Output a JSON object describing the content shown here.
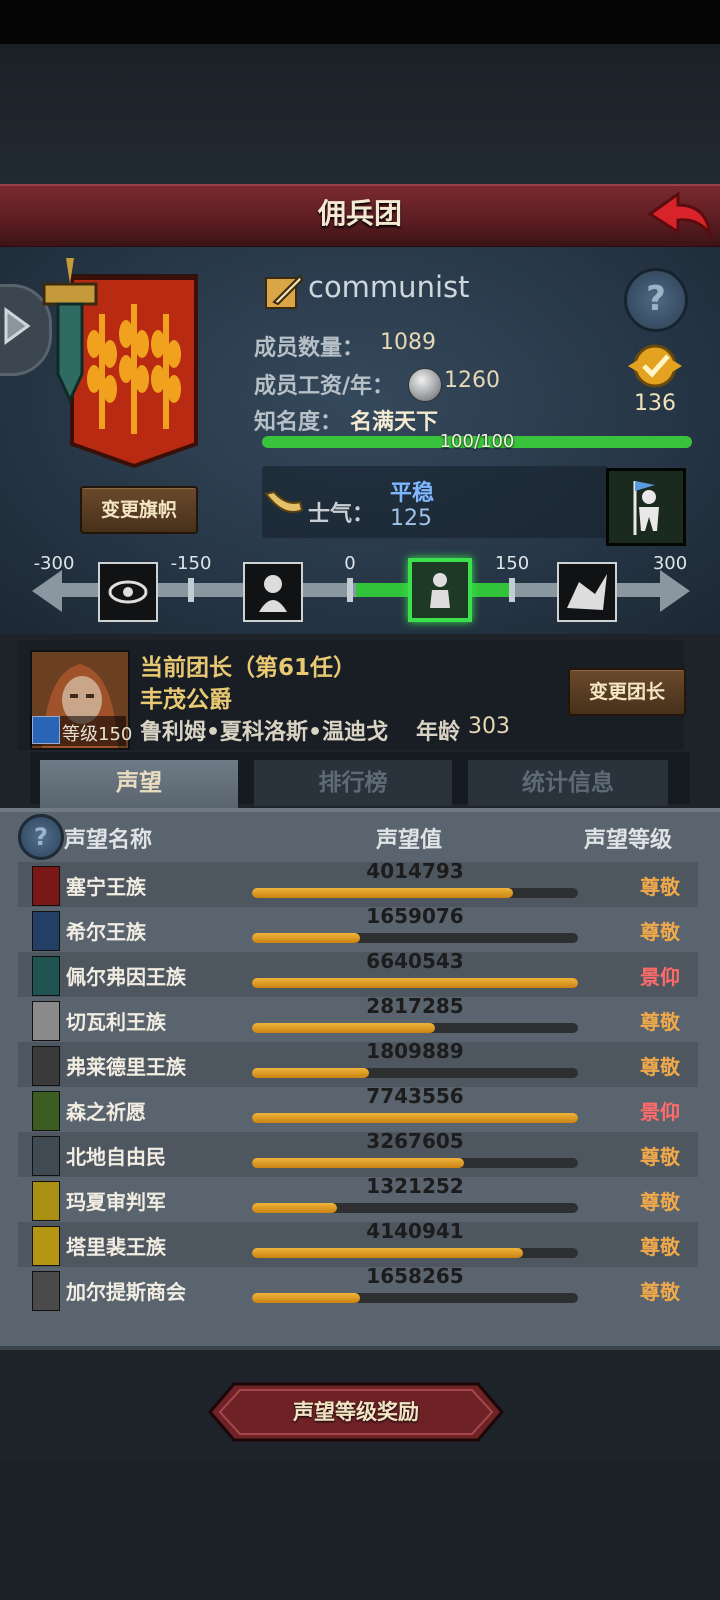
{
  "header": {
    "title": "佣兵团"
  },
  "guild": {
    "name": "communist",
    "members_label": "成员数量：",
    "members": "1089",
    "wage_label": "成员工资/年：",
    "wage": "1260",
    "fame_label": "知名度：",
    "fame_value": "名满天下",
    "fame_progress": "100/100",
    "fame_ratio": 1.0,
    "level": "136",
    "change_flag_label": "变更旗帜",
    "morale_label": "士气：",
    "morale_state": "平稳",
    "morale_value": "125"
  },
  "morale_scale": {
    "ticks": [
      "-300",
      "-150",
      "0",
      "150",
      "300"
    ]
  },
  "commander": {
    "title": "当前团长（第61任）",
    "rank": "丰茂公爵",
    "name": "鲁利姆•夏科洛斯•温迪戈",
    "age_label": "年龄",
    "age": "303",
    "level_label": "等级150",
    "change_label": "变更团长"
  },
  "tabs": [
    {
      "label": "声望",
      "active": true
    },
    {
      "label": "排行榜",
      "active": false
    },
    {
      "label": "统计信息",
      "active": false
    }
  ],
  "reputation": {
    "col_name": "声望名称",
    "col_value": "声望值",
    "col_level": "声望等级",
    "rows": [
      {
        "name": "塞宁王族",
        "value": "4014793",
        "ratio": 0.8,
        "level": "尊敬",
        "color": "#7a1818"
      },
      {
        "name": "希尔王族",
        "value": "1659076",
        "ratio": 0.33,
        "level": "尊敬",
        "color": "#233f66"
      },
      {
        "name": "佩尔弗因王族",
        "value": "6640543",
        "ratio": 1.0,
        "level": "景仰",
        "color": "#1f5452"
      },
      {
        "name": "切瓦利王族",
        "value": "2817285",
        "ratio": 0.56,
        "level": "尊敬",
        "color": "#8a8a8a"
      },
      {
        "name": "弗莱德里王族",
        "value": "1809889",
        "ratio": 0.36,
        "level": "尊敬",
        "color": "#3a3a3a"
      },
      {
        "name": "森之祈愿",
        "value": "7743556",
        "ratio": 1.0,
        "level": "景仰",
        "color": "#3b5d21"
      },
      {
        "name": "北地自由民",
        "value": "3267605",
        "ratio": 0.65,
        "level": "尊敬",
        "color": "#404a52"
      },
      {
        "name": "玛夏审判军",
        "value": "1321252",
        "ratio": 0.26,
        "level": "尊敬",
        "color": "#a98f12"
      },
      {
        "name": "塔里裴王族",
        "value": "4140941",
        "ratio": 0.83,
        "level": "尊敬",
        "color": "#b59612"
      },
      {
        "name": "加尔提斯商会",
        "value": "1658265",
        "ratio": 0.33,
        "level": "尊敬",
        "color": "#4a4a4a"
      }
    ],
    "level_colors": {
      "尊敬": "#f0a94a",
      "景仰": "#ff6a6a"
    }
  },
  "reward_button": {
    "label": "声望等级奖励"
  }
}
